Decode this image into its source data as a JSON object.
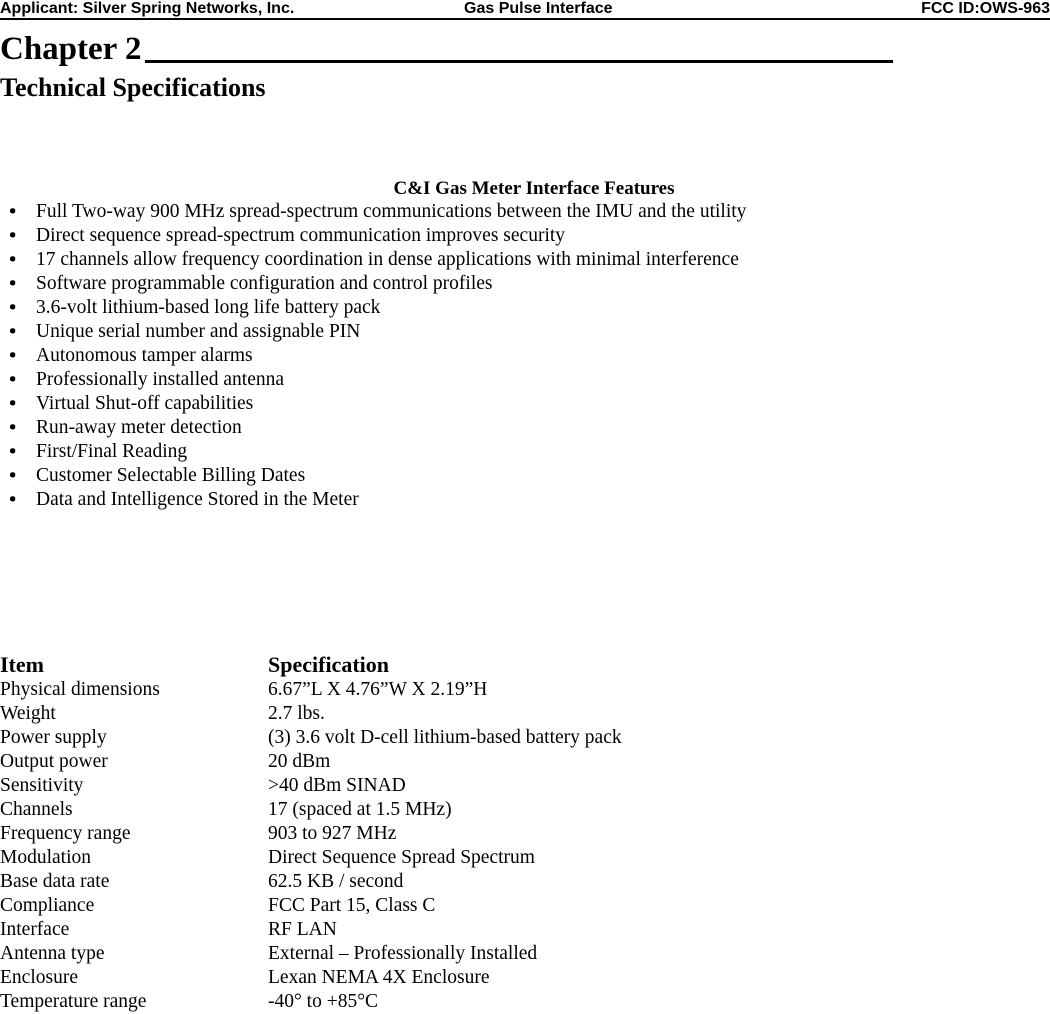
{
  "header": {
    "left": "Applicant:  Silver Spring Networks, Inc.",
    "center": "Gas Pulse Interface",
    "right": "FCC ID:OWS-963"
  },
  "chapter": {
    "title": "Chapter 2",
    "subtitle": "Technical Specifications"
  },
  "features": {
    "title": "C&I Gas Meter Interface Features",
    "bullet_glyph": "•",
    "items": [
      "Full Two-way 900 MHz spread-spectrum communications between the IMU and the utility",
      "Direct sequence spread-spectrum communication improves security",
      "17 channels allow frequency coordination in dense applications with minimal interference",
      "Software programmable configuration and control profiles",
      "3.6-volt lithium-based long life battery pack",
      "Unique serial number and assignable PIN",
      "Autonomous tamper alarms",
      "Professionally installed antenna",
      "Virtual Shut-off capabilities",
      "Run-away meter detection",
      "First/Final Reading",
      "Customer Selectable Billing Dates",
      "Data and Intelligence Stored in the Meter"
    ]
  },
  "spec_table": {
    "columns": [
      "Item",
      "Specification"
    ],
    "rows": [
      [
        "Physical dimensions",
        "6.67”L X 4.76”W X 2.19”H"
      ],
      [
        "Weight",
        "2.7 lbs."
      ],
      [
        "Power supply",
        "(3) 3.6 volt D-cell lithium-based battery pack"
      ],
      [
        "Output power",
        "20 dBm"
      ],
      [
        "Sensitivity",
        ">40 dBm SINAD"
      ],
      [
        "Channels",
        "17 (spaced at 1.5 MHz)"
      ],
      [
        "Frequency range",
        "903 to 927 MHz"
      ],
      [
        "Modulation",
        "Direct Sequence Spread Spectrum"
      ],
      [
        "Base data rate",
        "62.5 KB / second"
      ],
      [
        "Compliance",
        "FCC Part 15, Class C"
      ],
      [
        "Interface",
        "RF LAN"
      ],
      [
        "Antenna type",
        "External – Professionally Installed"
      ],
      [
        "Enclosure",
        "Lexan NEMA 4X Enclosure"
      ],
      [
        "Temperature range",
        "-40° to +85°C"
      ]
    ]
  },
  "colors": {
    "text": "#000000",
    "background": "#ffffff",
    "rule": "#000000"
  }
}
